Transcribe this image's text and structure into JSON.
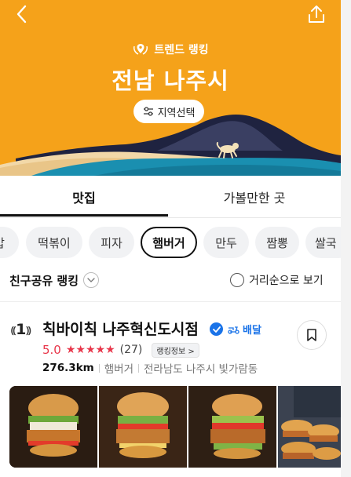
{
  "header": {
    "trend_label": "트렌드 랭킹",
    "region_title": "전남 나주시",
    "region_select_label": "지역선택"
  },
  "tabs": [
    {
      "label": "맛집",
      "active": true
    },
    {
      "label": "가볼만한 곳",
      "active": false
    }
  ],
  "chips": [
    {
      "label": "밥"
    },
    {
      "label": "떡볶이"
    },
    {
      "label": "피자"
    },
    {
      "label": "햄버거",
      "active": true
    },
    {
      "label": "만두"
    },
    {
      "label": "짬뽕"
    },
    {
      "label": "쌀국"
    }
  ],
  "ranking": {
    "title": "친구공유 랭킹",
    "sort_label": "거리순으로 보기"
  },
  "listing": {
    "rank": "1",
    "name": "칙바이칙 나주혁신도시점",
    "delivery_label": "배달",
    "rating": "5.0",
    "stars": "★★★★★",
    "review_count": "(27)",
    "rank_info_label": "랭킹정보 >",
    "distance": "276.3km",
    "category": "햄버거",
    "address": "전라남도 나주시 빛가람동",
    "photo_count": 4
  },
  "colors": {
    "hero_bg": "#f5a21a",
    "accent_red": "#e8364a",
    "accent_blue": "#1a73e8"
  }
}
